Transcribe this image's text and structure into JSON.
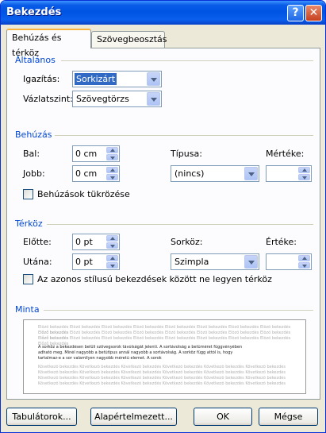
{
  "window": {
    "title": "Bekezdés"
  },
  "tabs": [
    {
      "label": "Behúzás és térköz"
    },
    {
      "label": "Szövegbeosztás"
    }
  ],
  "general": {
    "title": "Általános",
    "alignment_label": "Igazítás:",
    "alignment_value": "Sorkizárt",
    "outline_label": "Vázlatszint:",
    "outline_value": "Szövegtörzs"
  },
  "indent": {
    "title": "Behúzás",
    "left_label": "Bal:",
    "left_value": "0 cm",
    "right_label": "Jobb:",
    "right_value": "0 cm",
    "type_label": "Típusa:",
    "type_value": "(nincs)",
    "measure_label": "Mértéke:",
    "measure_value": "",
    "mirror_label": "Behúzások tükrözése"
  },
  "spacing": {
    "title": "Térköz",
    "before_label": "Előtte:",
    "before_value": "0 pt",
    "after_label": "Utána:",
    "after_value": "0 pt",
    "line_label": "Sorköz:",
    "line_value": "Szimpla",
    "value_label": "Értéke:",
    "value_value": "",
    "same_style_label": "Az azonos stílusú bekezdések között ne legyen térköz"
  },
  "preview": {
    "title": "Minta",
    "prev_line": "Előző bekezdés Előző bekezdés Előző bekezdés Előző bekezdés Előző bekezdés Előző bekezdés Előző bekezdés Előző bekezdés Előző bekezdés",
    "sample_1": "A sorköz a bekezdésen belüli szövegsorok távolságát jelenti. A sortávolság a betűméret függvényében",
    "sample_2": "adható meg. Minél nagyobb a betűtípus annál nagyobb a sortávolság. A sorköz függ attól is, hogy",
    "sample_3": "tartalmaz-e a sor valamilyen nagyobb méretű elemet. A sorok",
    "next_line": "Következő bekezdés Következő bekezdés Következő bekezdés Következő bekezdés Következő bekezdés Következő bekezdés"
  },
  "buttons": {
    "tabs": "Tabulátorok...",
    "default": "Alapértelmezett...",
    "ok": "OK",
    "cancel": "Mégse"
  }
}
